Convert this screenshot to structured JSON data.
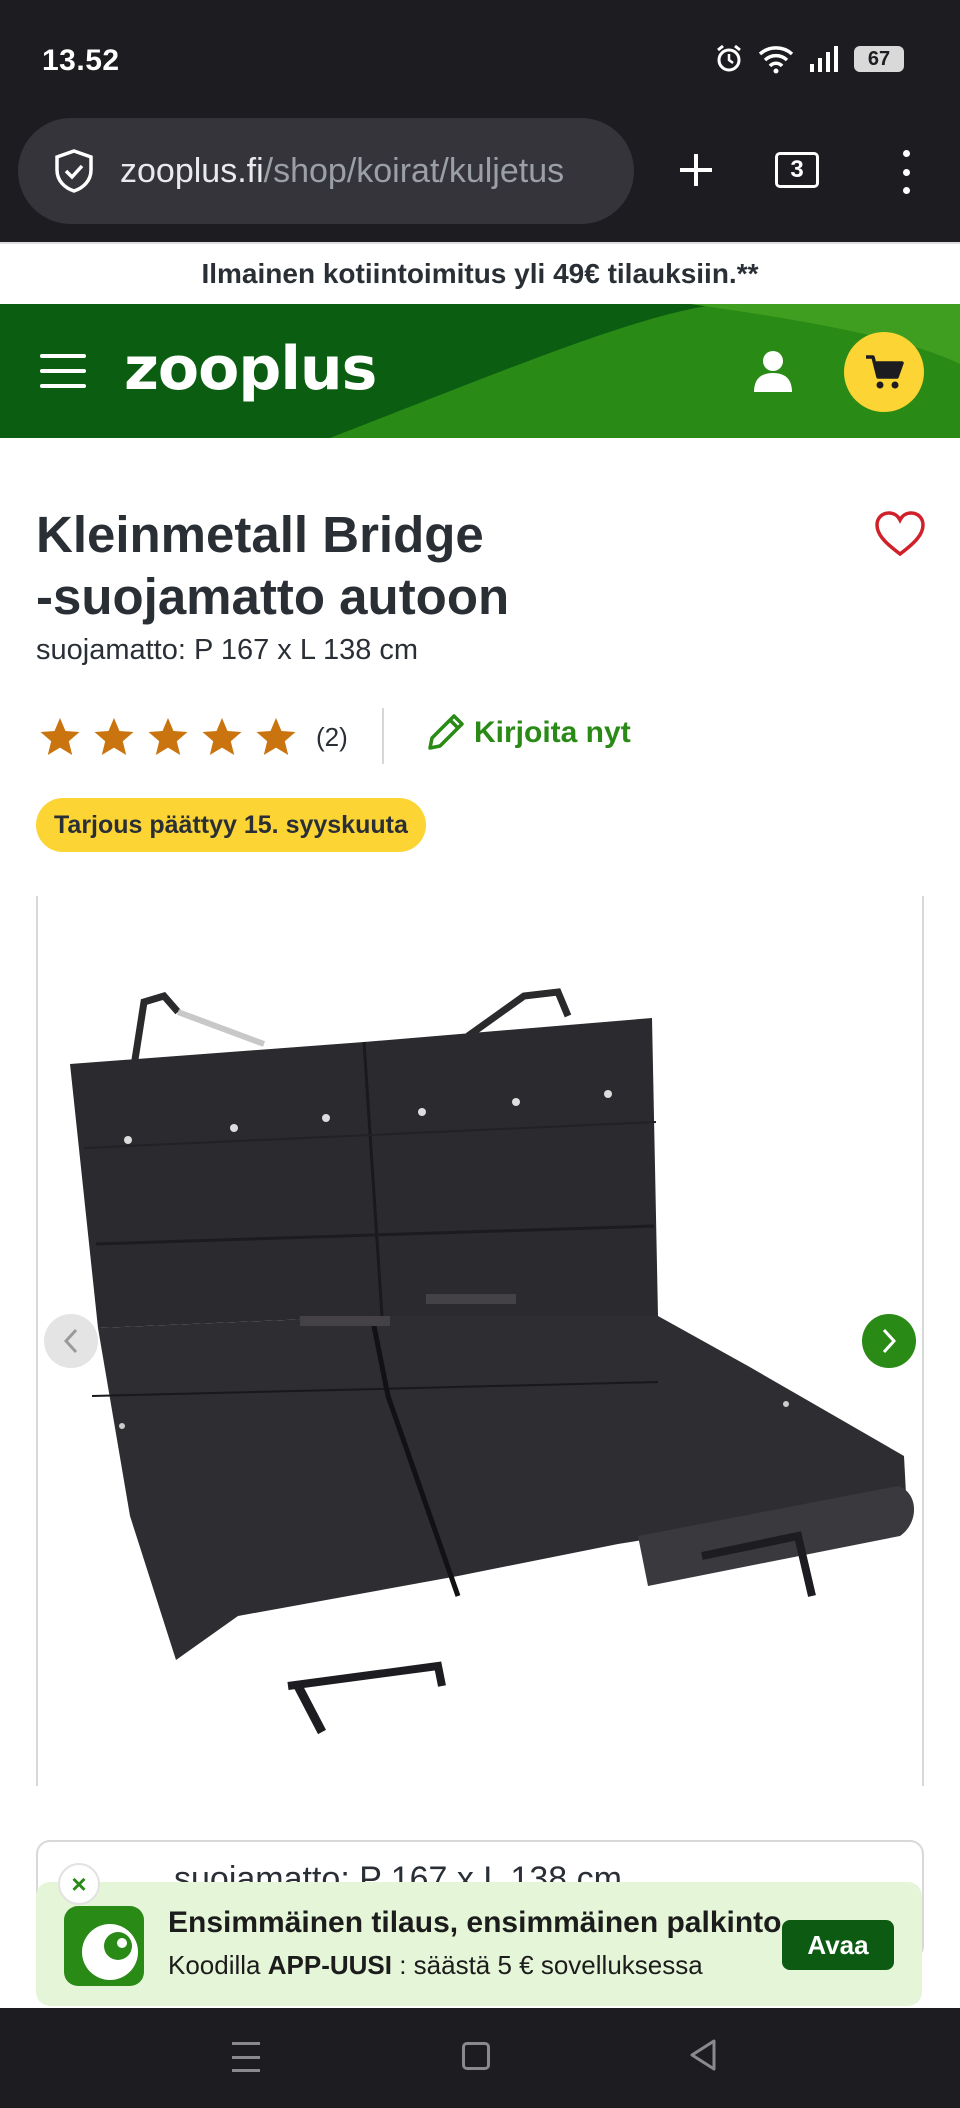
{
  "status_bar": {
    "time": "13.52",
    "battery": "67"
  },
  "browser": {
    "url_host": "zooplus.fi",
    "url_path": "/shop/koirat/kuljetus",
    "tab_count": "3"
  },
  "promo_banner": "Ilmainen kotiintoimitus yli 49€ tilauksiin.**",
  "header": {
    "logo": "zooplus",
    "brand_color": "#0b5d12",
    "cart_color": "#fcd535"
  },
  "product": {
    "title_line1": "Kleinmetall Bridge",
    "title_line2": "-suojamatto autoon",
    "variant_subtitle": "suojamatto: P 167 x L 138 cm",
    "rating": 5,
    "review_count": "(2)",
    "write_review": "Kirjoita nyt",
    "offer_badge": "Tarjous päättyy 15. syyskuuta",
    "variant_selected": "suojamatto: P 167 x L 138 cm"
  },
  "app_banner": {
    "title": "Ensimmäinen tilaus, ensimmäinen palkinto",
    "desc_prefix": "Koodilla ",
    "code": "APP-UUSI",
    "desc_suffix": " : säästä 5 € sovelluksessa",
    "button": "Avaa",
    "close": "×"
  },
  "icons": [
    "shield-icon",
    "plus-icon",
    "tabs-icon",
    "more-icon",
    "menu-icon",
    "user-icon",
    "cart-icon",
    "heart-icon",
    "star-icon",
    "pencil-icon",
    "chevron-left-icon",
    "chevron-right-icon",
    "close-icon",
    "recent-apps-icon",
    "home-icon",
    "back-icon"
  ]
}
